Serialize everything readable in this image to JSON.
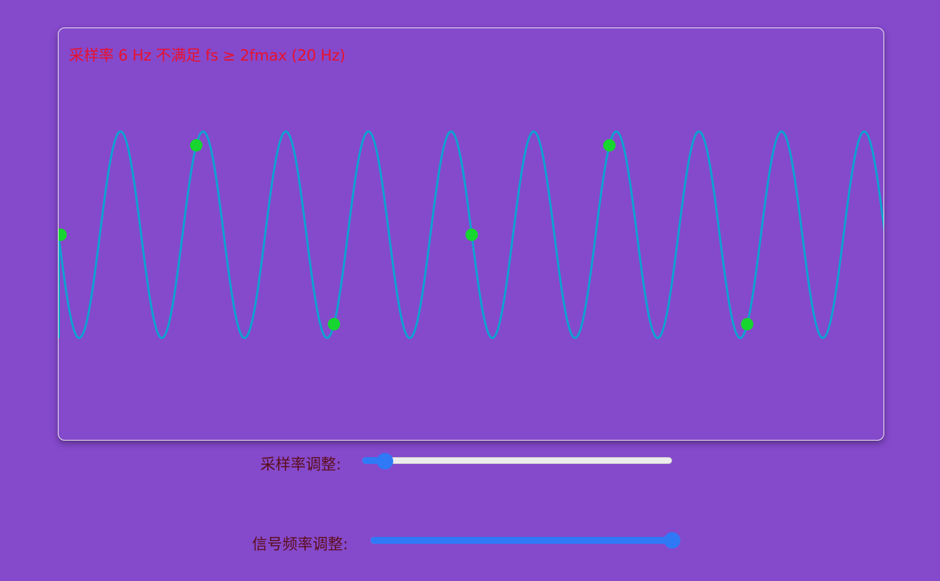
{
  "canvas": {
    "warning_text": "采样率 6 Hz 不满足 fs ≥ 2fmax (20 Hz)",
    "colors": {
      "background": "#8549cc",
      "wave": "#0ba4cf",
      "sample_point": "#16d62f",
      "warning": "#e8112d"
    }
  },
  "controls": {
    "sample_rate_label": "采样率调整:",
    "signal_freq_label": "信号频率调整:",
    "sample_rate_fraction": 0.05,
    "signal_freq_fraction": 1.0
  }
}
